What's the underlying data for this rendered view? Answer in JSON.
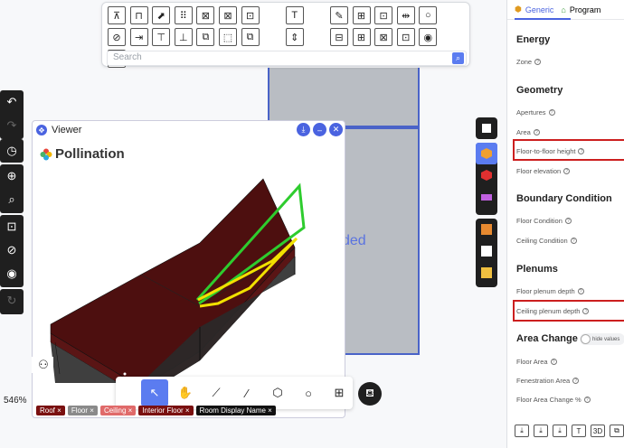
{
  "canvas": {
    "overlay_text": "ded"
  },
  "toolbar": {
    "search_placeholder": "Search",
    "row1": [
      "⊼",
      "⊓",
      "⬈",
      "⠿",
      "⊠",
      "⊠",
      "⊡",
      "",
      "T",
      "",
      "✎",
      "⊞",
      "⊡",
      "⇹",
      "○",
      "⊘"
    ],
    "row2": [
      "⇥",
      "⊤",
      "⊥",
      "⧉",
      "⬚",
      "⧉",
      "",
      "⇕",
      "",
      "⊟",
      "⊞",
      "⊠",
      "⊡",
      "◉",
      "⬭"
    ]
  },
  "viewer": {
    "title": "Viewer",
    "brand": "Pollination"
  },
  "zoom_level": "546%",
  "tags": [
    {
      "label": "Roof",
      "color": "#7a1010"
    },
    {
      "label": "Floor",
      "color": "#8a8a8a"
    },
    {
      "label": "Ceiling",
      "color": "#e06a6a"
    },
    {
      "label": "Interior Floor",
      "color": "#7a1010"
    },
    {
      "label": "Room Display Name",
      "color": "#111111"
    }
  ],
  "panel": {
    "tabs": [
      {
        "label": "Generic"
      },
      {
        "label": "Program"
      }
    ],
    "sections": {
      "energy": "Energy",
      "geometry": "Geometry",
      "boundary": "Boundary Condition",
      "plenums": "Plenums",
      "area_change": "Area Change"
    },
    "fields": {
      "zone": "Zone",
      "apertures": "Apertures",
      "area": "Area",
      "floor_to_floor": "Floor-to-floor height",
      "floor_elevation": "Floor elevation",
      "floor_condition": "Floor Condition",
      "ceiling_condition": "Ceiling Condition",
      "floor_plenum": "Floor plenum depth",
      "ceiling_plenum": "Ceiling plenum depth",
      "floor_area": "Floor Area",
      "fenestration_area": "Fenestration Area",
      "floor_area_change": "Floor Area Change %"
    },
    "toggle_label": "hide values",
    "bottom_buttons": [
      "⤓",
      "⤓",
      "⤓",
      "T",
      "3D",
      "⧉"
    ]
  },
  "colors": {
    "accent": "#4a63e0",
    "roof": "#4d0f0f",
    "highlight": "#cc1f1f"
  }
}
